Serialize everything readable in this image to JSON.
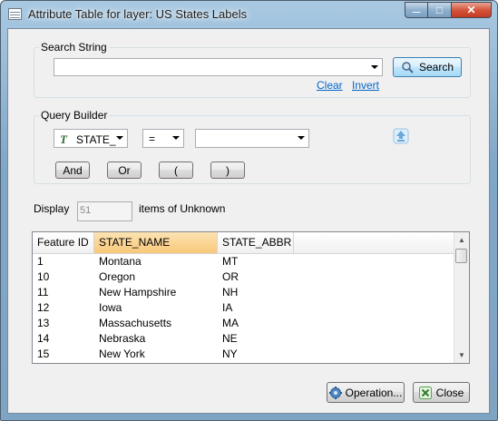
{
  "window": {
    "title": "Attribute Table for layer: US States Labels",
    "controls": {
      "minimize": "—",
      "maximize": "□",
      "close": "✕"
    }
  },
  "search": {
    "group_label": "Search String",
    "input_value": "",
    "search_label": "Search",
    "clear_label": "Clear",
    "invert_label": "Invert"
  },
  "query": {
    "group_label": "Query Builder",
    "field_value": "STATE_",
    "operator_value": "=",
    "value_value": "",
    "and_label": "And",
    "or_label": "Or",
    "open_paren": "(",
    "close_paren": ")"
  },
  "display": {
    "label": "Display",
    "count": "51",
    "suffix": "items of Unknown"
  },
  "table": {
    "columns": [
      "Feature ID",
      "STATE_NAME",
      "STATE_ABBR"
    ],
    "sorted_column": "STATE_NAME",
    "rows": [
      [
        "1",
        "Montana",
        "MT"
      ],
      [
        "10",
        "Oregon",
        "OR"
      ],
      [
        "11",
        "New Hampshire",
        "NH"
      ],
      [
        "12",
        "Iowa",
        "IA"
      ],
      [
        "13",
        "Massachusetts",
        "MA"
      ],
      [
        "14",
        "Nebraska",
        "NE"
      ],
      [
        "15",
        "New York",
        "NY"
      ]
    ]
  },
  "footer": {
    "operation_label": "Operation...",
    "close_label": "Close"
  },
  "colors": {
    "link": "#0066cc",
    "selected_header": "#f8c87a",
    "close_button": "#c43a22"
  },
  "icons": {
    "title": "table-icon",
    "search": "magnifier-icon",
    "field": "field-type-icon",
    "upload": "upload-arrow-icon",
    "operation": "gear-icon",
    "close": "close-x-icon"
  }
}
